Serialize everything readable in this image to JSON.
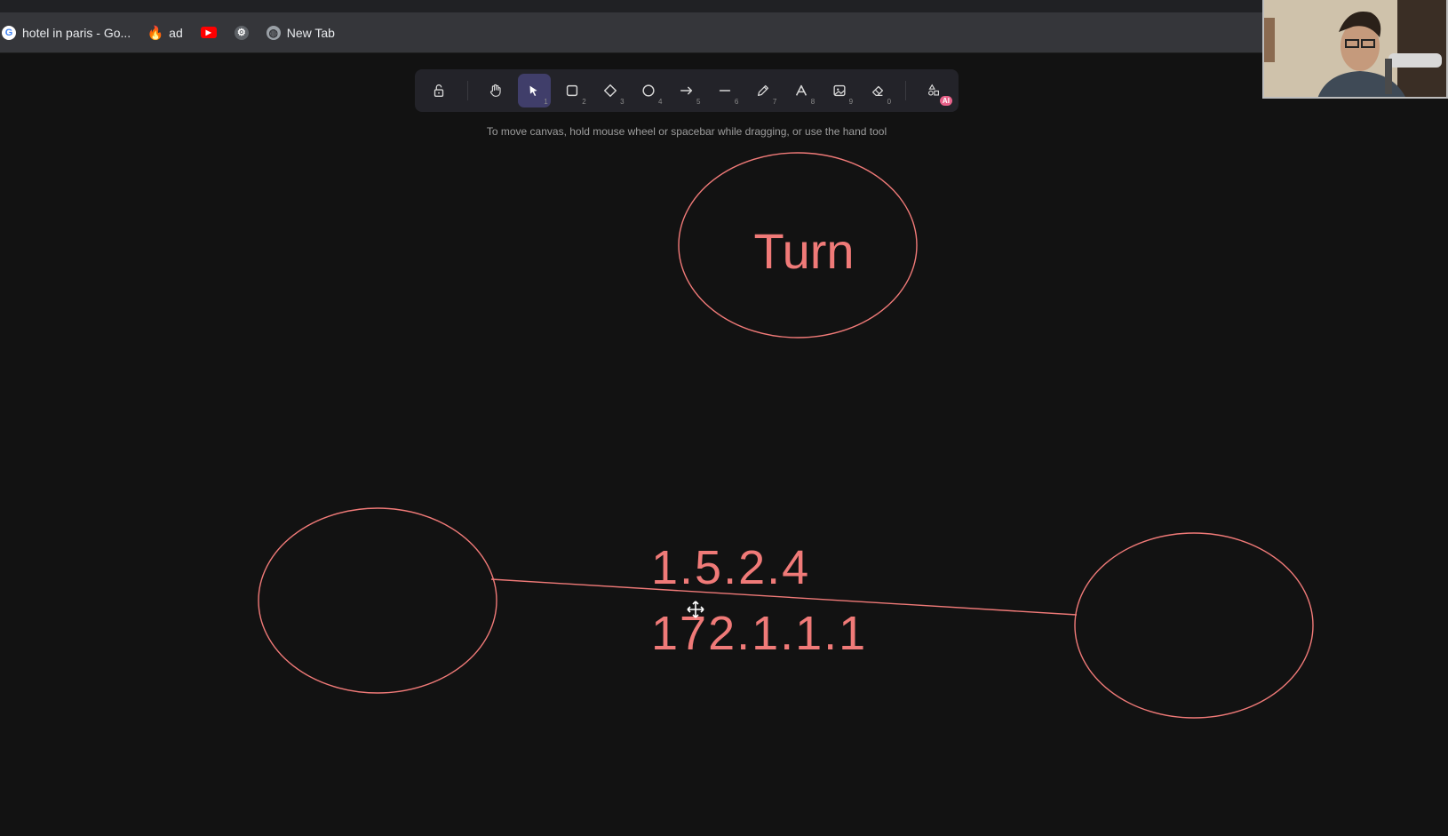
{
  "bookmarks": [
    {
      "label": "hotel in paris - Go...",
      "icon": "google-icon"
    },
    {
      "label": "ad",
      "icon": "flame-icon"
    },
    {
      "label": "",
      "icon": "youtube-icon"
    },
    {
      "label": "",
      "icon": "gear-icon"
    },
    {
      "label": "New Tab",
      "icon": "globe-icon"
    }
  ],
  "toolbar": {
    "tools": [
      {
        "name": "lock",
        "key": ""
      },
      {
        "name": "hand",
        "key": ""
      },
      {
        "name": "selection",
        "key": "1"
      },
      {
        "name": "rectangle",
        "key": "2"
      },
      {
        "name": "diamond",
        "key": "3"
      },
      {
        "name": "ellipse",
        "key": "4"
      },
      {
        "name": "arrow",
        "key": "5"
      },
      {
        "name": "line",
        "key": "6"
      },
      {
        "name": "draw",
        "key": "7"
      },
      {
        "name": "text",
        "key": "8"
      },
      {
        "name": "image",
        "key": "9"
      },
      {
        "name": "eraser",
        "key": "0"
      },
      {
        "name": "more-tools",
        "key": ""
      }
    ],
    "ai_badge": "AI",
    "hint": "To move canvas, hold mouse wheel or spacebar while dragging, or use the hand tool"
  },
  "canvas": {
    "stroke_color": "#f07a78",
    "top_label": "Turn",
    "ip_line_1": "1.5.2.4",
    "ip_line_2": "172.1.1.1"
  },
  "colors": {
    "canvas_bg": "#121212",
    "toolbar_bg": "#232329",
    "active_tool": "#403e6a",
    "accent": "#f07a78"
  }
}
